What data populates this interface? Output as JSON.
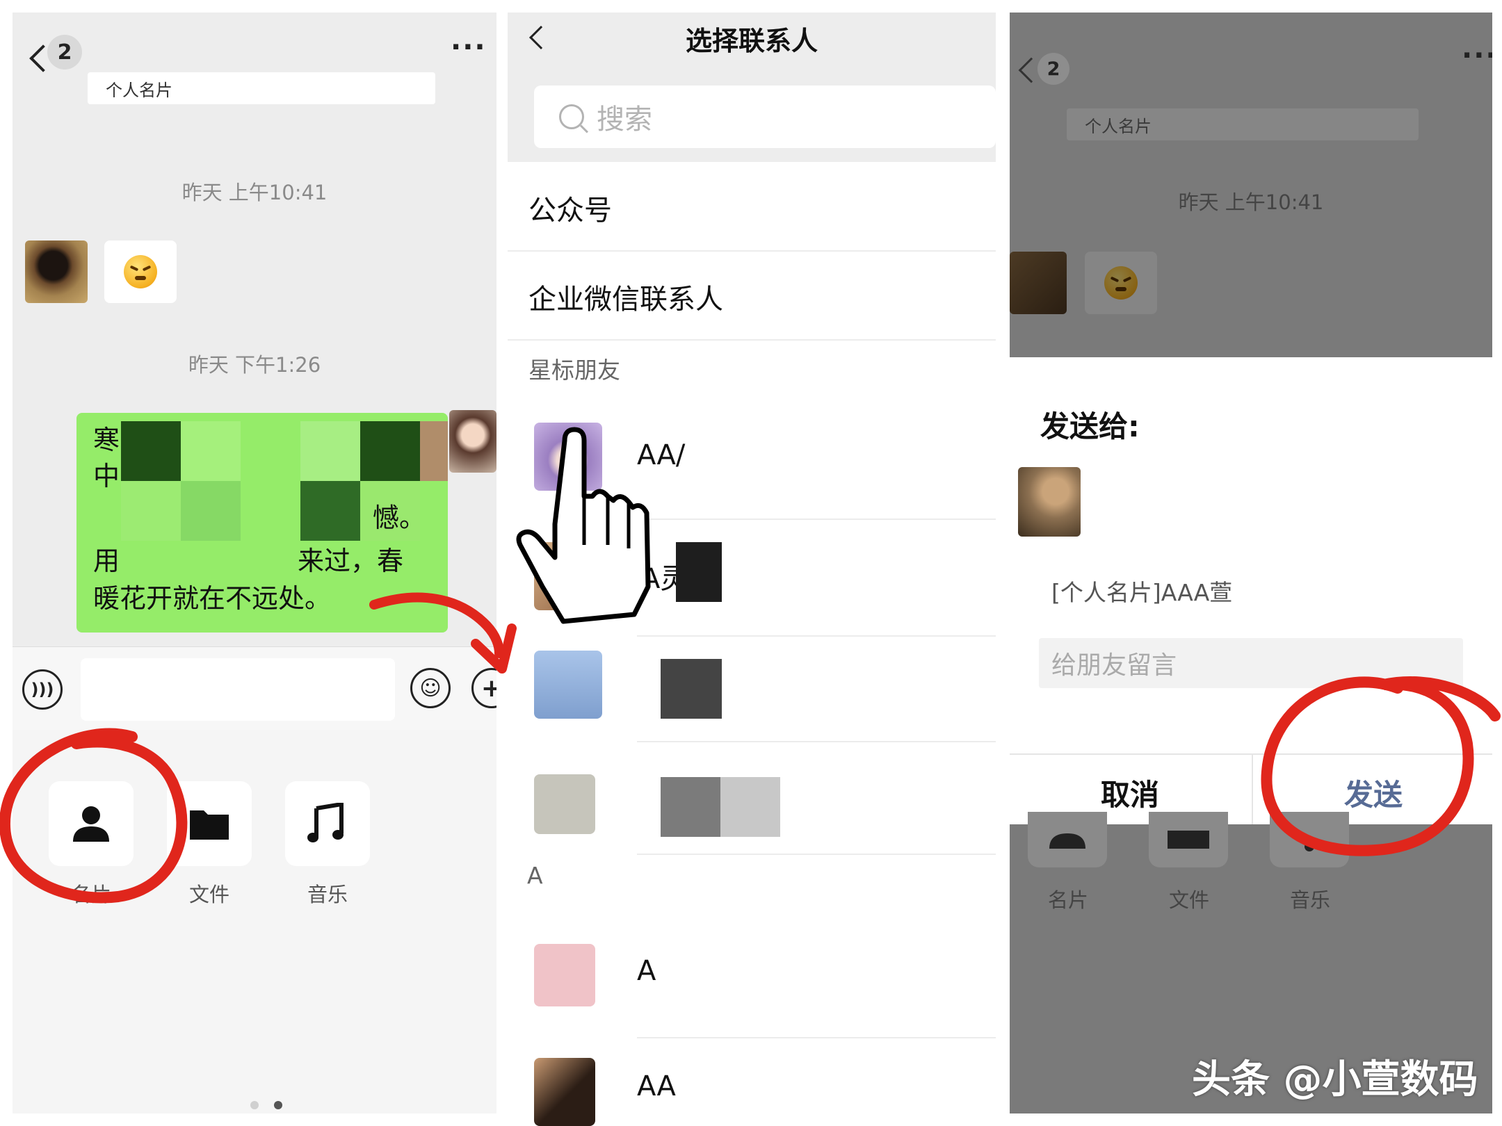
{
  "panel1": {
    "header": {
      "badge": "2",
      "more": "···"
    },
    "card_strip": "个人名片",
    "time1": "昨天 上午10:41",
    "time2": "昨天 下午1:26",
    "message_lines": [
      "寒",
      "中",
      "憾。",
      "用",
      "来过，春",
      "暖花开就在不远处。"
    ],
    "tools": [
      {
        "label": "名片",
        "icon": "contact-card-icon"
      },
      {
        "label": "文件",
        "icon": "folder-icon"
      },
      {
        "label": "音乐",
        "icon": "music-icon"
      }
    ],
    "colors": {
      "bubble_green": "#95ec69",
      "annotation_red": "#e0261c"
    }
  },
  "panel2": {
    "title": "选择联系人",
    "search_placeholder": "搜索",
    "rows": [
      "公众号",
      "企业微信联系人"
    ],
    "section_starred": "星标朋友",
    "section_a": "A",
    "contacts": [
      {
        "name": "AA/"
      },
      {
        "name": "A灵"
      },
      {
        "name": "A"
      },
      {
        "name": "AA"
      }
    ]
  },
  "panel3": {
    "header": {
      "badge": "2"
    },
    "card_strip": "个人名片",
    "time1": "昨天 上午10:41",
    "dialog": {
      "title": "发送给:",
      "card_text": "[个人名片]AAA萱",
      "message_placeholder": "给朋友留言",
      "cancel": "取消",
      "send": "发送"
    },
    "tray_labels": [
      "名片",
      "文件",
      "音乐"
    ],
    "watermark": "头条 @小萱数码",
    "colors": {
      "send_blue": "#576b95"
    }
  }
}
